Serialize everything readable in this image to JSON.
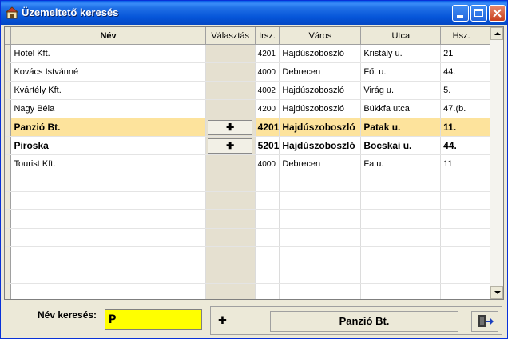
{
  "window": {
    "title": "Üzemeltető keresés"
  },
  "colors": {
    "highlight_row": "#fde39c",
    "search_bg": "#ffff00",
    "titlebar": "#0554d8"
  },
  "grid": {
    "headers": {
      "name": "Név",
      "select": "Választás",
      "zip": "Irsz.",
      "city": "Város",
      "street": "Utca",
      "house": "Hsz."
    },
    "rows": [
      {
        "name": "Hotel Kft.",
        "zip": "4201",
        "city": "Hajdúszoboszló",
        "street": "Kristály u.",
        "house": "21",
        "bold": false,
        "highlight": false,
        "button": false
      },
      {
        "name": "Kovács Istvánné",
        "zip": "4000",
        "city": "Debrecen",
        "street": "Fő. u.",
        "house": "44.",
        "bold": false,
        "highlight": false,
        "button": false
      },
      {
        "name": "Kvártély Kft.",
        "zip": "4002",
        "city": "Hajdúszoboszló",
        "street": "Virág u.",
        "house": "5.",
        "bold": false,
        "highlight": false,
        "button": false
      },
      {
        "name": "Nagy Béla",
        "zip": "4200",
        "city": "Hajdúszoboszló",
        "street": "Bükkfa utca",
        "house": "47.(b.",
        "bold": false,
        "highlight": false,
        "button": false
      },
      {
        "name": "Panzió Bt.",
        "zip": "4201",
        "city": "Hajdúszoboszló",
        "street": "Patak u.",
        "house": "11.",
        "bold": true,
        "highlight": true,
        "button": true
      },
      {
        "name": "Piroska",
        "zip": "5201",
        "city": "Hajdúszoboszló",
        "street": "Bocskai u.",
        "house": "44.",
        "bold": true,
        "highlight": false,
        "button": true
      },
      {
        "name": "Tourist Kft.",
        "zip": "4000",
        "city": "Debrecen",
        "street": "Fa u.",
        "house": "11",
        "bold": false,
        "highlight": false,
        "button": false
      }
    ],
    "empty_rows": 7,
    "select_button_icon": "plus-icon"
  },
  "search": {
    "label": "Név keresés:",
    "value": "P"
  },
  "selection": {
    "selected_name": "Panzió Bt.",
    "icon": "plus-icon"
  },
  "exit": {
    "icon": "exit-door-icon"
  }
}
